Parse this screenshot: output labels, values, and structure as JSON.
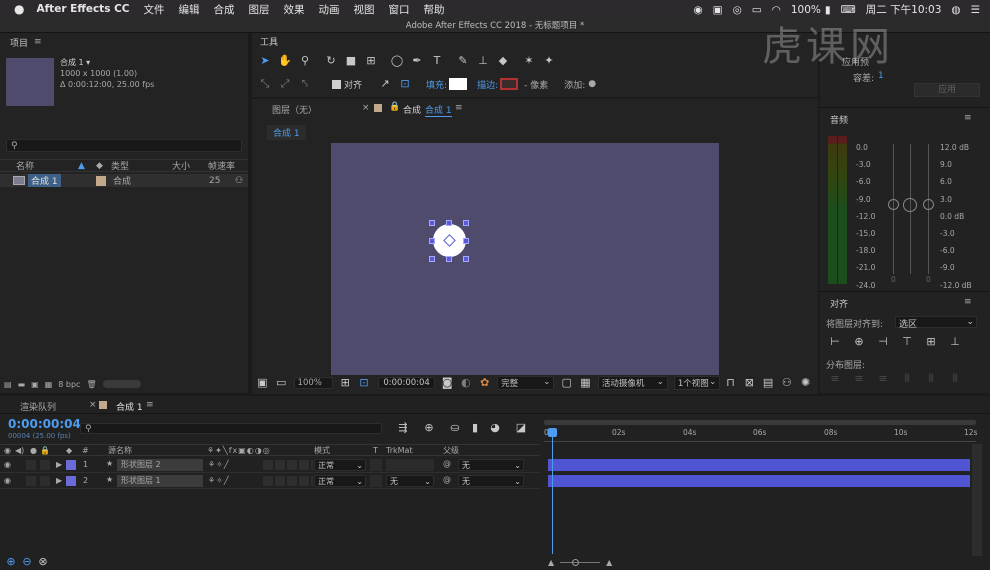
{
  "menubar": {
    "apple_icon": "apple-icon",
    "app_name": "After Effects CC",
    "menus": [
      "文件",
      "编辑",
      "合成",
      "图层",
      "效果",
      "动画",
      "视图",
      "窗口",
      "帮助"
    ],
    "status": {
      "battery": "100%",
      "clock": "周二 下午10:03"
    }
  },
  "window_title": "Adobe After Effects CC 2018 - 无标题项目 *",
  "project_panel": {
    "title": "项目",
    "item_name": "合成 1 ▾",
    "item_info_1": "1000 x 1000 (1.00)",
    "item_info_2": "Δ 0:00:12:00, 25.00 fps",
    "columns": {
      "name": "名称",
      "type": "类型",
      "size": "大小",
      "fps": "帧速率"
    },
    "rows": [
      {
        "name": "合成 1",
        "type": "合成",
        "fps": "25"
      }
    ],
    "bpc": "8 bpc"
  },
  "tools_panel": {
    "title": "工具",
    "align_label": "对齐",
    "fill_label": "填充:",
    "stroke_label": "描边:",
    "stroke_unit": "- 像素",
    "add_label": "添加:"
  },
  "viewer": {
    "layer_tab": "图层（无）",
    "comp_tab_prefix": "合成",
    "comp_tab_name": "合成 1",
    "breadcrumb": "合成 1",
    "zoom": "100%",
    "timecode": "0:00:00:04",
    "quality": "完整",
    "camera": "活动摄像机",
    "views": "1个视图"
  },
  "right_panel": {
    "top_label_1": "应用预",
    "tolerance_label": "容差:",
    "tolerance_value": "1",
    "apply_button": "应用",
    "audio_title": "音频",
    "audio_left_scale": [
      "0.0",
      "-3.0",
      "-6.0",
      "-9.0",
      "-12.0",
      "-15.0",
      "-18.0",
      "-21.0",
      "-24.0"
    ],
    "audio_right_scale": [
      "12.0 dB",
      "9.0",
      "6.0",
      "3.0",
      "0.0 dB",
      "-3.0",
      "-6.0",
      "-9.0",
      "-12.0 dB"
    ],
    "audio_zero_labels": [
      "0",
      "0"
    ],
    "align_title": "对齐",
    "align_to_label": "将图层对齐到:",
    "align_to_value": "选区",
    "distribute_label": "分布图层:"
  },
  "watermark": "虎课网",
  "timeline": {
    "render_queue_tab": "渲染队列",
    "comp_tab": "合成 1",
    "timecode": "0:00:00:04",
    "timecode_sub": "00004 (25.00 fps)",
    "columns": {
      "num": "#",
      "source": "源名称",
      "mode": "模式",
      "t": "T",
      "trkmat": "TrkMat",
      "parent": "父级"
    },
    "ruler": [
      "0s",
      "02s",
      "04s",
      "06s",
      "08s",
      "10s",
      "12s"
    ],
    "layers": [
      {
        "index": "1",
        "name": "形状图层 2",
        "mode": "正常",
        "trkmat": "",
        "parent": "无"
      },
      {
        "index": "2",
        "name": "形状图层 1",
        "mode": "正常",
        "trkmat": "无",
        "parent": "无"
      }
    ]
  },
  "colors": {
    "accent": "#4d9cf0",
    "layer_bar": "#4f55d3",
    "comp_bg": "#4e4b6c",
    "label_swatch": "#6a6ad8",
    "tan_swatch": "#c3a98b"
  }
}
